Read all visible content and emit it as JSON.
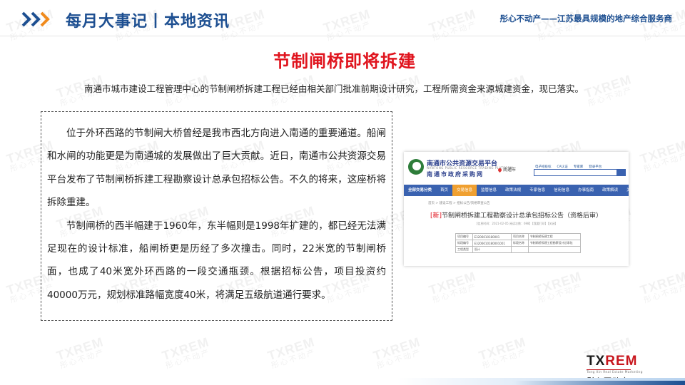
{
  "header": {
    "title": "每月大事记丨本地资讯",
    "slogan": "彤心不动产——江苏最具规模的地产综合服务商"
  },
  "watermark": {
    "brand_en": "TXREM",
    "brand_cn": "彤心不动产"
  },
  "article": {
    "title": "节制闸桥即将拆建",
    "intro": "南通市城市建设工程管理中心的节制闸桥拆建工程已经由相关部门批准前期设计研究，工程所需资金来源城建资金，现已落实。",
    "paragraph_1": "位于外环西路的节制闸大桥曾经是我市西北方向进入南通的重要通道。船闸和水闸的功能更是为南通城的发展做出了巨大贡献。近日，南通市公共资源交易平台发布了节制闸桥拆建工程勘察设计总承包招标公告。不久的将来，这座桥将拆除重建。",
    "paragraph_2": "节制闸桥的西半幅建于1960年，东半幅则是1998年扩建的，都已经无法满足现在的设计标准，船闸桥更是历经了多次撞击。同时，22米宽的节制闸桥面，也成了40米宽外环西路的一段交通瓶颈。根据招标公告，项目投资约40000万元，规划标准路幅宽度40米，将满足五级航道通行要求。"
  },
  "screenshot": {
    "site_name": "南通市公共资源交易平台",
    "site_sub": "NANTONG PUBLIC RESOURCE TRADING PLATFORM",
    "site_name_2": "南通市政府采购网",
    "city": "南通市",
    "top_links": [
      "电子招投标",
      "CA认证",
      "专家库",
      "登录平台"
    ],
    "nav": [
      "全部交易分类",
      "首页",
      "交易信息",
      "监管信息",
      "政策法规",
      "专家信息",
      "信用信息",
      "办事指南",
      "政策解读",
      "关于我"
    ],
    "crumb": "首页 > 建设工程 > 招标公告/资格审查公告",
    "heading_tag": "[新]",
    "heading": "节制闸桥拆建工程勘察设计总承包招标公告（资格后审）",
    "meta": "【信息时间：2021-02-05 阅读次数：698】【我要打印】【关闭】",
    "table": [
      [
        "项目编号",
        "E3206010180001",
        "项目名称",
        "节制闸桥拆建工程"
      ],
      [
        "标段编号",
        "E3206010180001001",
        "标段名称",
        "节制闸桥拆建工程勘察设计总承包"
      ],
      [
        "工程类型",
        "设计",
        "",
        ""
      ]
    ]
  },
  "brand": {
    "en_dark": "TX",
    "en_red": "REM",
    "tagline": "Tong Xin Real Estate Marketing",
    "cn": "彤心不动产"
  }
}
